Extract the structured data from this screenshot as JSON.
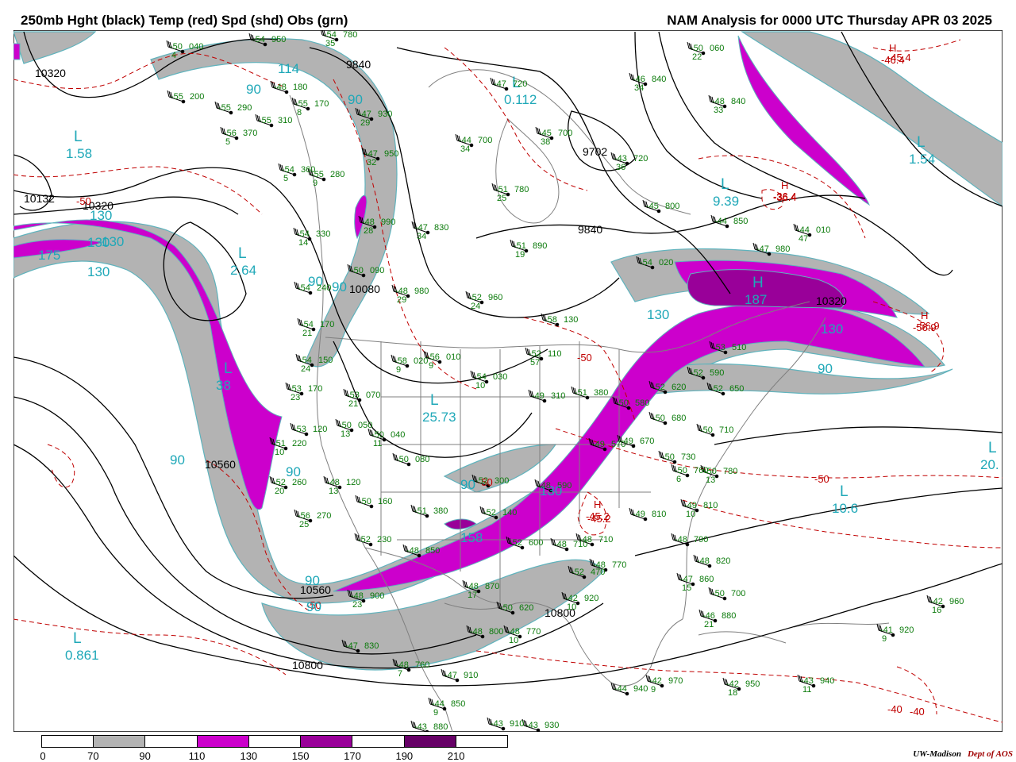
{
  "header": {
    "left_title": "250mb Hght (black) Temp (red) Spd (shd) Obs (grn)",
    "right_title": "NAM Analysis for 0000 UTC Thursday  APR 03 2025"
  },
  "legend": {
    "ticks": [
      "0",
      "70",
      "90",
      "110",
      "130",
      "150",
      "170",
      "190",
      "210"
    ],
    "segments": [
      "#ffffff",
      "#b3b3b3",
      "#ffffff",
      "#cc00cc",
      "#ffffff",
      "#990099",
      "#ffffff",
      "#660066",
      "#ffffff"
    ]
  },
  "credit": {
    "org": "UW-Madison",
    "dept": "Dept of AOS"
  },
  "colors": {
    "height": "#000000",
    "temp": "#c00000",
    "speed_label": "#1fa8b8",
    "obs": "#0a7a0a",
    "shade_70": "#b3b3b3",
    "shade_110": "#cc00cc",
    "shade_150": "#990099",
    "shade_190": "#660066",
    "basemap": "#7f7f7f"
  },
  "height_labels": [
    "10320",
    "10132",
    "10320",
    "9840",
    "10080",
    "9702",
    "9840",
    "10320",
    "10560",
    "10560",
    "10800",
    "10800"
  ],
  "temp_labels": [
    "-45.4",
    "-36.4",
    "-50",
    "-56.9",
    "-50",
    "-45.2",
    "-40",
    "-40",
    "-50",
    "-50",
    "-50"
  ],
  "centers": [
    {
      "letter": "L",
      "value": "1.58",
      "color": "speed"
    },
    {
      "letter": "L",
      "value": "2.64",
      "color": "speed"
    },
    {
      "letter": "L",
      "value": "38",
      "color": "speed"
    },
    {
      "letter": "L",
      "value": "0.861",
      "color": "speed"
    },
    {
      "letter": "L",
      "value": "0.112",
      "color": "speed"
    },
    {
      "letter": "L",
      "value": "9.39",
      "color": "speed"
    },
    {
      "letter": "L",
      "value": "1.54",
      "color": "speed"
    },
    {
      "letter": "L",
      "value": "10.6",
      "color": "speed"
    },
    {
      "letter": "L",
      "value": "20.",
      "color": "speed"
    },
    {
      "letter": "L",
      "value": "25.73",
      "color": "speed"
    },
    {
      "letter": "H",
      "value": "187",
      "color": "speed"
    },
    {
      "letter": "H",
      "value": "-36.4",
      "color": "temp"
    },
    {
      "letter": "H",
      "value": "-45.2",
      "color": "temp"
    },
    {
      "letter": "H",
      "value": "-56.9",
      "color": "temp"
    },
    {
      "letter": "H",
      "value": "-46.4",
      "color": "temp"
    }
  ],
  "speed_labels": [
    "114",
    "90",
    "90",
    "90",
    "130",
    "130",
    "175",
    "130",
    "90",
    "90",
    "130",
    "90",
    "90",
    "130",
    "130",
    "158",
    "90",
    "90",
    "130",
    "90"
  ],
  "observations": [
    {
      "t": "-50",
      "h": "040",
      "d": "4"
    },
    {
      "t": "-54",
      "h": "950",
      "d": ""
    },
    {
      "t": "-54",
      "h": "780",
      "d": "35"
    },
    {
      "t": "-55",
      "h": "200",
      "d": ""
    },
    {
      "t": "-55",
      "h": "290",
      "d": ""
    },
    {
      "t": "-55",
      "h": "170",
      "d": "8"
    },
    {
      "t": "-48",
      "h": "180",
      "d": ""
    },
    {
      "t": "-55",
      "h": "310",
      "d": ""
    },
    {
      "t": "-56",
      "h": "370",
      "d": "5"
    },
    {
      "t": "-54",
      "h": "360",
      "d": "5"
    },
    {
      "t": "-55",
      "h": "280",
      "d": "9"
    },
    {
      "t": "-47",
      "h": "930",
      "d": "29"
    },
    {
      "t": "-47",
      "h": "950",
      "d": "32"
    },
    {
      "t": "-47",
      "h": "720",
      "d": ""
    },
    {
      "t": "-44",
      "h": "700",
      "d": "34"
    },
    {
      "t": "-45",
      "h": "700",
      "d": "38"
    },
    {
      "t": "-43",
      "h": "720",
      "d": "36"
    },
    {
      "t": "-50",
      "h": "060",
      "d": "22"
    },
    {
      "t": "-46",
      "h": "840",
      "d": "34"
    },
    {
      "t": "-48",
      "h": "840",
      "d": "33"
    },
    {
      "t": "-51",
      "h": "780",
      "d": "25"
    },
    {
      "t": "-47",
      "h": "830",
      "d": "34"
    },
    {
      "t": "-48",
      "h": "990",
      "d": "28"
    },
    {
      "t": "-54",
      "h": "330",
      "d": "14"
    },
    {
      "t": "-50",
      "h": "090",
      "d": ""
    },
    {
      "t": "-51",
      "h": "890",
      "d": "19"
    },
    {
      "t": "-45",
      "h": "800",
      "d": ""
    },
    {
      "t": "-44",
      "h": "850",
      "d": ""
    },
    {
      "t": "-44",
      "h": "010",
      "d": "47"
    },
    {
      "t": "-47",
      "h": "980",
      "d": ""
    },
    {
      "t": "-54",
      "h": "020",
      "d": ""
    },
    {
      "t": "-48",
      "h": "980",
      "d": "29"
    },
    {
      "t": "-52",
      "h": "960",
      "d": "24"
    },
    {
      "t": "-54",
      "h": "240",
      "d": ""
    },
    {
      "t": "-54",
      "h": "170",
      "d": "21"
    },
    {
      "t": "-58",
      "h": "130",
      "d": ""
    },
    {
      "t": "-53",
      "h": "510",
      "d": ""
    },
    {
      "t": "-54",
      "h": "150",
      "d": "24"
    },
    {
      "t": "-58",
      "h": "020",
      "d": "9"
    },
    {
      "t": "-56",
      "h": "010",
      "d": "9"
    },
    {
      "t": "-52",
      "h": "110",
      "d": "57"
    },
    {
      "t": "-53",
      "h": "170",
      "d": "23"
    },
    {
      "t": "-53",
      "h": "070",
      "d": "21"
    },
    {
      "t": "-54",
      "h": "030",
      "d": "10"
    },
    {
      "t": "-49",
      "h": "310",
      "d": ""
    },
    {
      "t": "-51",
      "h": "380",
      "d": ""
    },
    {
      "t": "-52",
      "h": "590",
      "d": ""
    },
    {
      "t": "-52",
      "h": "620",
      "d": ""
    },
    {
      "t": "-52",
      "h": "650",
      "d": ""
    },
    {
      "t": "-53",
      "h": "120",
      "d": ""
    },
    {
      "t": "-50",
      "h": "050",
      "d": "13"
    },
    {
      "t": "-50",
      "h": "040",
      "d": "11"
    },
    {
      "t": "-50",
      "h": "580",
      "d": ""
    },
    {
      "t": "-50",
      "h": "680",
      "d": ""
    },
    {
      "t": "-50",
      "h": "710",
      "d": ""
    },
    {
      "t": "-51",
      "h": "220",
      "d": "10"
    },
    {
      "t": "-50",
      "h": "080",
      "d": ""
    },
    {
      "t": "-49",
      "h": "570",
      "d": ""
    },
    {
      "t": "-49",
      "h": "670",
      "d": ""
    },
    {
      "t": "-50",
      "h": "730",
      "d": ""
    },
    {
      "t": "-52",
      "h": "260",
      "d": "20"
    },
    {
      "t": "-48",
      "h": "120",
      "d": "13"
    },
    {
      "t": "-52",
      "h": "300",
      "d": ""
    },
    {
      "t": "-48",
      "h": "590",
      "d": ""
    },
    {
      "t": "-48",
      "h": "710",
      "d": ""
    },
    {
      "t": "-50",
      "h": "760",
      "d": "6"
    },
    {
      "t": "-50",
      "h": "780",
      "d": "13"
    },
    {
      "t": "-56",
      "h": "270",
      "d": "25"
    },
    {
      "t": "-50",
      "h": "160",
      "d": ""
    },
    {
      "t": "-51",
      "h": "380",
      "d": ""
    },
    {
      "t": "-52",
      "h": "140",
      "d": ""
    },
    {
      "t": "-49",
      "h": "810",
      "d": "10"
    },
    {
      "t": "-49",
      "h": "810",
      "d": ""
    },
    {
      "t": "-52",
      "h": "230",
      "d": ""
    },
    {
      "t": "-52",
      "h": "600",
      "d": ""
    },
    {
      "t": "-48",
      "h": "710",
      "d": ""
    },
    {
      "t": "-48",
      "h": "790",
      "d": ""
    },
    {
      "t": "-48",
      "h": "850",
      "d": ""
    },
    {
      "t": "-52",
      "h": "470",
      "d": ""
    },
    {
      "t": "-48",
      "h": "770",
      "d": ""
    },
    {
      "t": "-48",
      "h": "820",
      "d": ""
    },
    {
      "t": "-47",
      "h": "860",
      "d": "15"
    },
    {
      "t": "-48",
      "h": "870",
      "d": "17"
    },
    {
      "t": "-50",
      "h": "700",
      "d": ""
    },
    {
      "t": "-46",
      "h": "880",
      "d": "21"
    },
    {
      "t": "-48",
      "h": "900",
      "d": "23"
    },
    {
      "t": "-50",
      "h": "620",
      "d": ""
    },
    {
      "t": "-48",
      "h": "800",
      "d": ""
    },
    {
      "t": "-48",
      "h": "770",
      "d": "10"
    },
    {
      "t": "-47",
      "h": "830",
      "d": ""
    },
    {
      "t": "-48",
      "h": "760",
      "d": "7"
    },
    {
      "t": "-47",
      "h": "910",
      "d": ""
    },
    {
      "t": "-44",
      "h": "850",
      "d": "9"
    },
    {
      "t": "-43",
      "h": "880",
      "d": ""
    },
    {
      "t": "-43",
      "h": "910",
      "d": ""
    },
    {
      "t": "-43",
      "h": "930",
      "d": ""
    },
    {
      "t": "-44",
      "h": "940",
      "d": ""
    },
    {
      "t": "-42",
      "h": "970",
      "d": "9"
    },
    {
      "t": "-42",
      "h": "950",
      "d": "18"
    },
    {
      "t": "-43",
      "h": "940",
      "d": "11"
    },
    {
      "t": "-42",
      "h": "960",
      "d": "16"
    },
    {
      "t": "-41",
      "h": "920",
      "d": "9"
    },
    {
      "t": "-42",
      "h": "920",
      "d": "10"
    },
    {
      "t": "-48",
      "h": "760",
      "d": ""
    }
  ]
}
